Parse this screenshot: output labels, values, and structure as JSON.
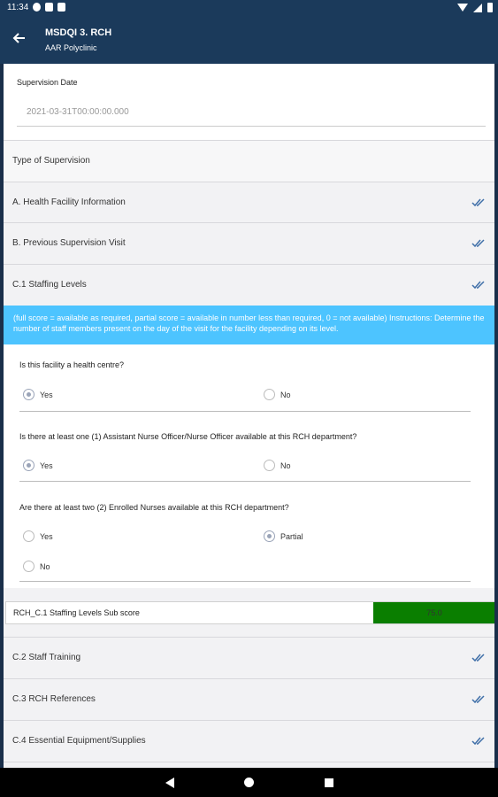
{
  "status_bar": {
    "time": "11:34",
    "icons_left": [
      "gmail-icon",
      "app-icon",
      "sd-card-icon"
    ],
    "icons_right": [
      "wifi-icon",
      "signal-icon",
      "battery-icon"
    ]
  },
  "app_bar": {
    "title": "MSDQI 3. RCH",
    "subtitle": "AAR Polyclinic",
    "back_icon": "arrow-left-icon"
  },
  "supervision_date": {
    "label": "Supervision Date",
    "value": "2021-03-31T00:00:00.000"
  },
  "type_of_supervision": "Type of Supervision",
  "sections_top": [
    {
      "label": "A. Health Facility Information",
      "icon": "double-check-icon"
    },
    {
      "label": "B. Previous Supervision Visit",
      "icon": "double-check-icon"
    },
    {
      "label": "C.1 Staffing Levels",
      "icon": "double-check-icon"
    }
  ],
  "instructions": "(full score = available as required, partial score = available in number less than required, 0 = not available) Instructions: Determine the number of staff members present on the day of the visit for the facility depending on its level.",
  "questions": [
    {
      "text": "Is this facility a health centre?",
      "options": [
        {
          "label": "Yes",
          "selected": true
        },
        {
          "label": "No",
          "selected": false
        }
      ]
    },
    {
      "text": "Is there at least one (1) Assistant Nurse Officer/Nurse Officer available at this RCH department?",
      "options": [
        {
          "label": "Yes",
          "selected": true
        },
        {
          "label": "No",
          "selected": false
        }
      ]
    },
    {
      "text": "Are there at least two (2) Enrolled Nurses available at this RCH department?",
      "options": [
        {
          "label": "Yes",
          "selected": false
        },
        {
          "label": "Partial",
          "selected": true
        },
        {
          "label": "No",
          "selected": false
        }
      ]
    }
  ],
  "subscore": {
    "label": "RCH_C.1 Staffing Levels Sub score",
    "value": "75.0",
    "color": "#0a7e00"
  },
  "sections_bottom": [
    {
      "label": "C.2 Staff Training",
      "icon": "double-check-icon"
    },
    {
      "label": "C.3 RCH References",
      "icon": "double-check-icon"
    },
    {
      "label": "C.4 Essential Equipment/Supplies",
      "icon": "double-check-icon"
    }
  ],
  "colors": {
    "app_bar": "#1b3a5b",
    "banner": "#4dc4ff",
    "check": "#3f6fa8"
  }
}
